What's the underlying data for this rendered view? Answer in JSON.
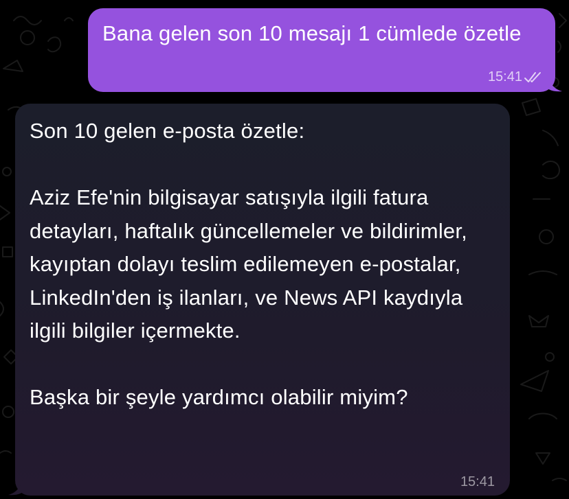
{
  "outgoing": {
    "text": "Bana gelen son 10 mesajı 1 cümlede özetle",
    "time": "15:41",
    "status_icon": "double-check-icon",
    "color": "#9552de"
  },
  "incoming": {
    "heading": "Son 10 gelen e-posta özetle:",
    "summary": "Aziz Efe'nin bilgisayar satışıyla ilgili fatura detayları, haftalık güncellemeler ve bildirimler, kayıptan dolayı teslim edilemeyen e-postalar, LinkedIn'den iş ilanları, ve News API kaydıyla ilgili bilgiler içermekte.",
    "closing": "Başka bir şeyle yardımcı olabilir miyim?",
    "time": "15:41",
    "color": "#1e1c2c"
  }
}
